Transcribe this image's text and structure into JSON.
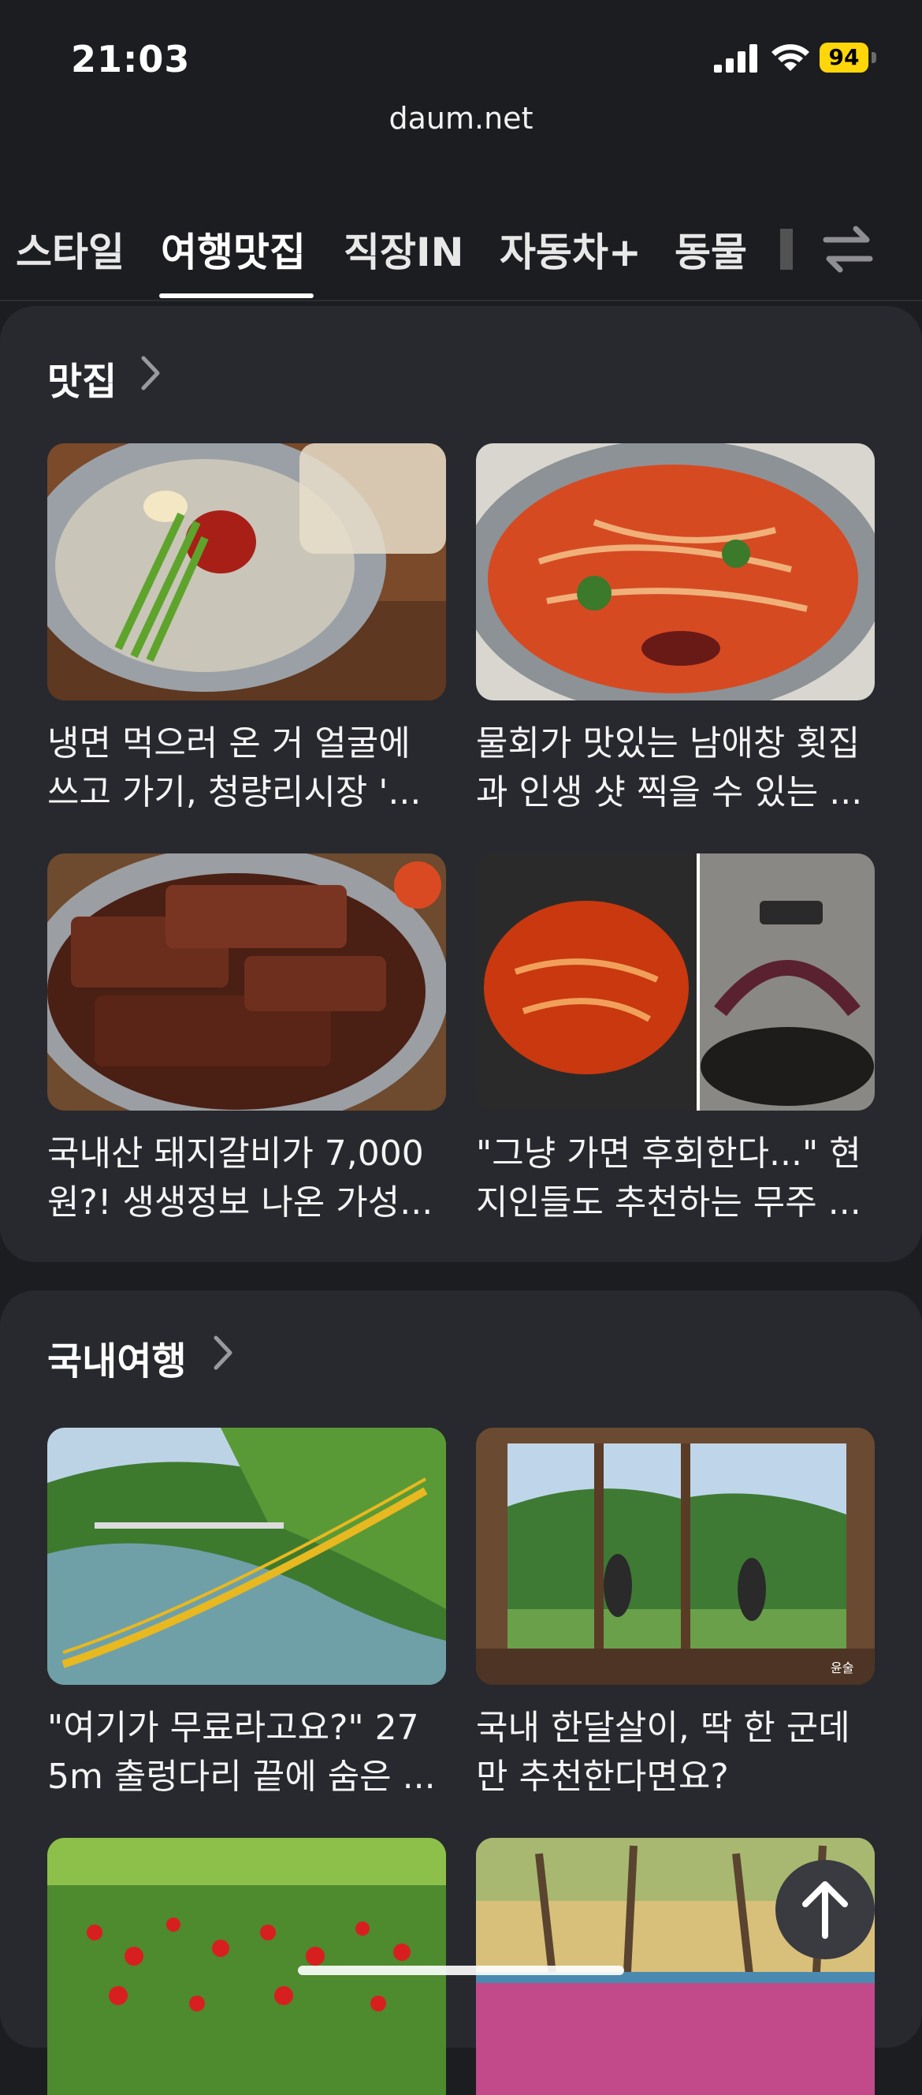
{
  "status_bar": {
    "time": "21:03",
    "battery": "94",
    "icons": [
      "cellular-signal-icon",
      "wifi-icon",
      "battery-icon"
    ]
  },
  "browser": {
    "url": "daum.net"
  },
  "tabs": [
    {
      "label": "스타일",
      "active": false
    },
    {
      "label": "여행맛집",
      "active": true
    },
    {
      "label": "직장IN",
      "active": false
    },
    {
      "label": "자동차+",
      "active": false
    },
    {
      "label": "동물",
      "active": false
    }
  ],
  "sections": [
    {
      "title": "맛집",
      "items": [
        {
          "line1": "냉면 먹으러 온 거 얼굴에",
          "line2": "쓰고 가기, 청량리시장 '..."
        },
        {
          "line1": "물회가 맛있는 남애창 횟집",
          "line2": "과 인생 샷 찍을 수 있는 ..."
        },
        {
          "line1": "국내산 돼지갈비가 7,000",
          "line2": "원?! 생생정보 나온 가성..."
        },
        {
          "line1": "\"그냥 가면 후회한다...\" 현",
          "line2": "지인들도 추천하는 무주 ..."
        }
      ]
    },
    {
      "title": "국내여행",
      "items": [
        {
          "line1": "\"여기가 무료라고요?\" 27",
          "line2": "5m 출렁다리 끝에 숨은 ..."
        },
        {
          "line1": "국내 한달살이, 딱 한 군데",
          "line2": "만 추천한다면요?"
        }
      ]
    }
  ],
  "image_watermark": "윤술",
  "colors": {
    "background": "#1c1d21",
    "card": "#28292e",
    "battery": "#ffd60a"
  }
}
